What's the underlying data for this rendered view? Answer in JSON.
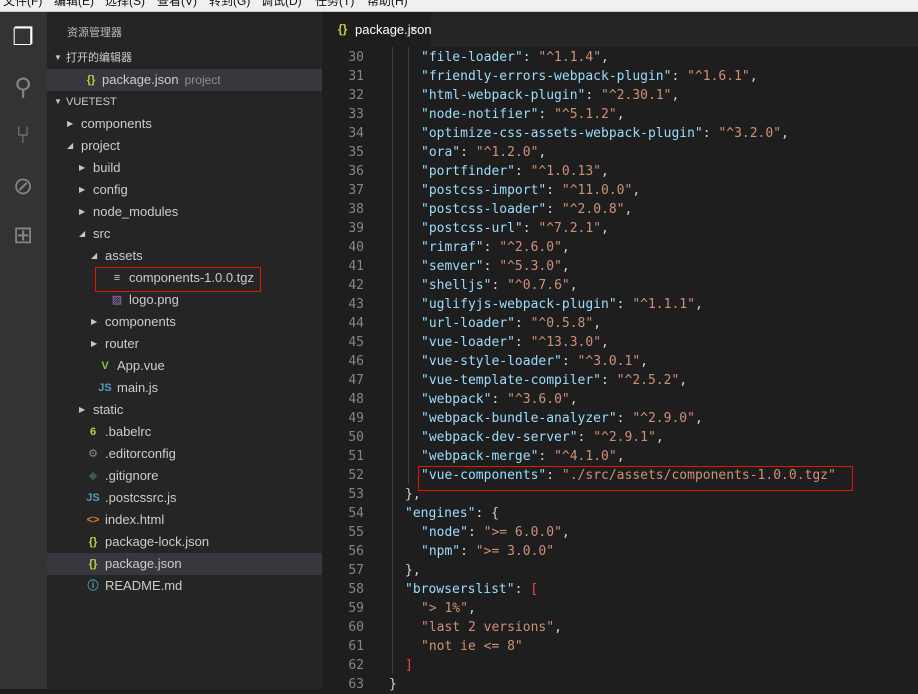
{
  "menu": [
    "文件(F)",
    "编辑(E)",
    "选择(S)",
    "查看(V)",
    "转到(G)",
    "调试(D)",
    "任务(T)",
    "帮助(H)"
  ],
  "activity": [
    {
      "icon": "files-icon",
      "glyph": "❐"
    },
    {
      "icon": "search-icon",
      "glyph": "⚲"
    },
    {
      "icon": "source-control-icon",
      "glyph": "⑂"
    },
    {
      "icon": "debug-icon",
      "glyph": "⊘"
    },
    {
      "icon": "extensions-icon",
      "glyph": "⊞"
    }
  ],
  "sidebar": {
    "title": "资源管理器",
    "open_editors_label": "打开的编辑器",
    "open_editor": {
      "name": "package.json",
      "desc": "project"
    },
    "workspace_label": "VUETEST"
  },
  "tree": [
    {
      "name": "components",
      "type": "folder",
      "depth": 0,
      "expanded": false
    },
    {
      "name": "project",
      "type": "folder",
      "depth": 0,
      "expanded": true
    },
    {
      "name": "build",
      "type": "folder",
      "depth": 1,
      "expanded": false
    },
    {
      "name": "config",
      "type": "folder",
      "depth": 1,
      "expanded": false
    },
    {
      "name": "node_modules",
      "type": "folder",
      "depth": 1,
      "expanded": false
    },
    {
      "name": "src",
      "type": "folder",
      "depth": 1,
      "expanded": true
    },
    {
      "name": "assets",
      "type": "folder",
      "depth": 2,
      "expanded": true
    },
    {
      "name": "components-1.0.0.tgz",
      "type": "file",
      "depth": 3,
      "icon": "≡",
      "color": "#cccccc",
      "highlight": true
    },
    {
      "name": "logo.png",
      "type": "file",
      "depth": 3,
      "icon": "▨",
      "color": "#a074c4"
    },
    {
      "name": "components",
      "type": "folder",
      "depth": 2,
      "expanded": false
    },
    {
      "name": "router",
      "type": "folder",
      "depth": 2,
      "expanded": false
    },
    {
      "name": "App.vue",
      "type": "file",
      "depth": 2,
      "icon": "V",
      "color": "#8dc149"
    },
    {
      "name": "main.js",
      "type": "file",
      "depth": 2,
      "icon": "JS",
      "color": "#519aba"
    },
    {
      "name": "static",
      "type": "folder",
      "depth": 1,
      "expanded": false
    },
    {
      "name": ".babelrc",
      "type": "file",
      "depth": 1,
      "icon": "6",
      "color": "#cbcb41"
    },
    {
      "name": ".editorconfig",
      "type": "file",
      "depth": 1,
      "icon": "⚙",
      "color": "#8a8a8a"
    },
    {
      "name": ".gitignore",
      "type": "file",
      "depth": 1,
      "icon": "◆",
      "color": "#41535b"
    },
    {
      "name": ".postcssrc.js",
      "type": "file",
      "depth": 1,
      "icon": "JS",
      "color": "#519aba"
    },
    {
      "name": "index.html",
      "type": "file",
      "depth": 1,
      "icon": "<>",
      "color": "#e37933"
    },
    {
      "name": "package-lock.json",
      "type": "file",
      "depth": 1,
      "icon": "{}",
      "color": "#cbcb41"
    },
    {
      "name": "package.json",
      "type": "file",
      "depth": 1,
      "icon": "{}",
      "color": "#cbcb41",
      "selected": true
    },
    {
      "name": "README.md",
      "type": "file",
      "depth": 1,
      "icon": "ⓘ",
      "color": "#519aba"
    }
  ],
  "tab": {
    "icon": "{}",
    "name": "package.json",
    "close": "×"
  },
  "code": [
    {
      "n": 30,
      "i": 1,
      "t": [
        [
          "k",
          "\"file-loader\""
        ],
        [
          "p",
          ": "
        ],
        [
          "s",
          "\"^1.1.4\""
        ],
        [
          "p",
          ","
        ]
      ]
    },
    {
      "n": 31,
      "i": 1,
      "t": [
        [
          "k",
          "\"friendly-errors-webpack-plugin\""
        ],
        [
          "p",
          ": "
        ],
        [
          "s",
          "\"^1.6.1\""
        ],
        [
          "p",
          ","
        ]
      ]
    },
    {
      "n": 32,
      "i": 1,
      "t": [
        [
          "k",
          "\"html-webpack-plugin\""
        ],
        [
          "p",
          ": "
        ],
        [
          "s",
          "\"^2.30.1\""
        ],
        [
          "p",
          ","
        ]
      ]
    },
    {
      "n": 33,
      "i": 1,
      "t": [
        [
          "k",
          "\"node-notifier\""
        ],
        [
          "p",
          ": "
        ],
        [
          "s",
          "\"^5.1.2\""
        ],
        [
          "p",
          ","
        ]
      ]
    },
    {
      "n": 34,
      "i": 1,
      "t": [
        [
          "k",
          "\"optimize-css-assets-webpack-plugin\""
        ],
        [
          "p",
          ": "
        ],
        [
          "s",
          "\"^3.2.0\""
        ],
        [
          "p",
          ","
        ]
      ]
    },
    {
      "n": 35,
      "i": 1,
      "t": [
        [
          "k",
          "\"ora\""
        ],
        [
          "p",
          ": "
        ],
        [
          "s",
          "\"^1.2.0\""
        ],
        [
          "p",
          ","
        ]
      ]
    },
    {
      "n": 36,
      "i": 1,
      "t": [
        [
          "k",
          "\"portfinder\""
        ],
        [
          "p",
          ": "
        ],
        [
          "s",
          "\"^1.0.13\""
        ],
        [
          "p",
          ","
        ]
      ]
    },
    {
      "n": 37,
      "i": 1,
      "t": [
        [
          "k",
          "\"postcss-import\""
        ],
        [
          "p",
          ": "
        ],
        [
          "s",
          "\"^11.0.0\""
        ],
        [
          "p",
          ","
        ]
      ]
    },
    {
      "n": 38,
      "i": 1,
      "t": [
        [
          "k",
          "\"postcss-loader\""
        ],
        [
          "p",
          ": "
        ],
        [
          "s",
          "\"^2.0.8\""
        ],
        [
          "p",
          ","
        ]
      ]
    },
    {
      "n": 39,
      "i": 1,
      "t": [
        [
          "k",
          "\"postcss-url\""
        ],
        [
          "p",
          ": "
        ],
        [
          "s",
          "\"^7.2.1\""
        ],
        [
          "p",
          ","
        ]
      ]
    },
    {
      "n": 40,
      "i": 1,
      "t": [
        [
          "k",
          "\"rimraf\""
        ],
        [
          "p",
          ": "
        ],
        [
          "s",
          "\"^2.6.0\""
        ],
        [
          "p",
          ","
        ]
      ]
    },
    {
      "n": 41,
      "i": 1,
      "t": [
        [
          "k",
          "\"semver\""
        ],
        [
          "p",
          ": "
        ],
        [
          "s",
          "\"^5.3.0\""
        ],
        [
          "p",
          ","
        ]
      ]
    },
    {
      "n": 42,
      "i": 1,
      "t": [
        [
          "k",
          "\"shelljs\""
        ],
        [
          "p",
          ": "
        ],
        [
          "s",
          "\"^0.7.6\""
        ],
        [
          "p",
          ","
        ]
      ]
    },
    {
      "n": 43,
      "i": 1,
      "t": [
        [
          "k",
          "\"uglifyjs-webpack-plugin\""
        ],
        [
          "p",
          ": "
        ],
        [
          "s",
          "\"^1.1.1\""
        ],
        [
          "p",
          ","
        ]
      ]
    },
    {
      "n": 44,
      "i": 1,
      "t": [
        [
          "k",
          "\"url-loader\""
        ],
        [
          "p",
          ": "
        ],
        [
          "s",
          "\"^0.5.8\""
        ],
        [
          "p",
          ","
        ]
      ]
    },
    {
      "n": 45,
      "i": 1,
      "t": [
        [
          "k",
          "\"vue-loader\""
        ],
        [
          "p",
          ": "
        ],
        [
          "s",
          "\"^13.3.0\""
        ],
        [
          "p",
          ","
        ]
      ]
    },
    {
      "n": 46,
      "i": 1,
      "t": [
        [
          "k",
          "\"vue-style-loader\""
        ],
        [
          "p",
          ": "
        ],
        [
          "s",
          "\"^3.0.1\""
        ],
        [
          "p",
          ","
        ]
      ]
    },
    {
      "n": 47,
      "i": 1,
      "t": [
        [
          "k",
          "\"vue-template-compiler\""
        ],
        [
          "p",
          ": "
        ],
        [
          "s",
          "\"^2.5.2\""
        ],
        [
          "p",
          ","
        ]
      ]
    },
    {
      "n": 48,
      "i": 1,
      "t": [
        [
          "k",
          "\"webpack\""
        ],
        [
          "p",
          ": "
        ],
        [
          "s",
          "\"^3.6.0\""
        ],
        [
          "p",
          ","
        ]
      ]
    },
    {
      "n": 49,
      "i": 1,
      "t": [
        [
          "k",
          "\"webpack-bundle-analyzer\""
        ],
        [
          "p",
          ": "
        ],
        [
          "s",
          "\"^2.9.0\""
        ],
        [
          "p",
          ","
        ]
      ]
    },
    {
      "n": 50,
      "i": 1,
      "t": [
        [
          "k",
          "\"webpack-dev-server\""
        ],
        [
          "p",
          ": "
        ],
        [
          "s",
          "\"^2.9.1\""
        ],
        [
          "p",
          ","
        ]
      ]
    },
    {
      "n": 51,
      "i": 1,
      "t": [
        [
          "k",
          "\"webpack-merge\""
        ],
        [
          "p",
          ": "
        ],
        [
          "s",
          "\"^4.1.0\""
        ],
        [
          "p",
          ","
        ]
      ]
    },
    {
      "n": 52,
      "i": 1,
      "t": [
        [
          "k",
          "\"vue-components\""
        ],
        [
          "p",
          ": "
        ],
        [
          "s",
          "\"./src/assets/components-1.0.0.tgz\""
        ]
      ],
      "highlight": true
    },
    {
      "n": 53,
      "i": 0,
      "t": [
        [
          "p",
          "},"
        ]
      ]
    },
    {
      "n": 54,
      "i": 0,
      "t": [
        [
          "k",
          "\"engines\""
        ],
        [
          "p",
          ": {"
        ]
      ]
    },
    {
      "n": 55,
      "i": 1,
      "t": [
        [
          "k",
          "\"node\""
        ],
        [
          "p",
          ": "
        ],
        [
          "s",
          "\">= 6.0.0\""
        ],
        [
          "p",
          ","
        ]
      ]
    },
    {
      "n": 56,
      "i": 1,
      "t": [
        [
          "k",
          "\"npm\""
        ],
        [
          "p",
          ": "
        ],
        [
          "s",
          "\">= 3.0.0\""
        ]
      ]
    },
    {
      "n": 57,
      "i": 0,
      "t": [
        [
          "p",
          "},"
        ]
      ]
    },
    {
      "n": 58,
      "i": 0,
      "t": [
        [
          "k",
          "\"browserslist\""
        ],
        [
          "p",
          ": "
        ],
        [
          "b",
          "["
        ]
      ]
    },
    {
      "n": 59,
      "i": 1,
      "t": [
        [
          "s",
          "\"> 1%\""
        ],
        [
          "p",
          ","
        ]
      ]
    },
    {
      "n": 60,
      "i": 1,
      "t": [
        [
          "s",
          "\"last 2 versions\""
        ],
        [
          "p",
          ","
        ]
      ]
    },
    {
      "n": 61,
      "i": 1,
      "t": [
        [
          "s",
          "\"not ie <= 8\""
        ]
      ]
    },
    {
      "n": 62,
      "i": 0,
      "t": [
        [
          "b",
          "]"
        ]
      ]
    },
    {
      "n": 63,
      "i": -1,
      "t": [
        [
          "p",
          "}"
        ]
      ]
    }
  ],
  "colors": {
    "highlight_box": "#e51400",
    "accent": "#cbcb41"
  }
}
